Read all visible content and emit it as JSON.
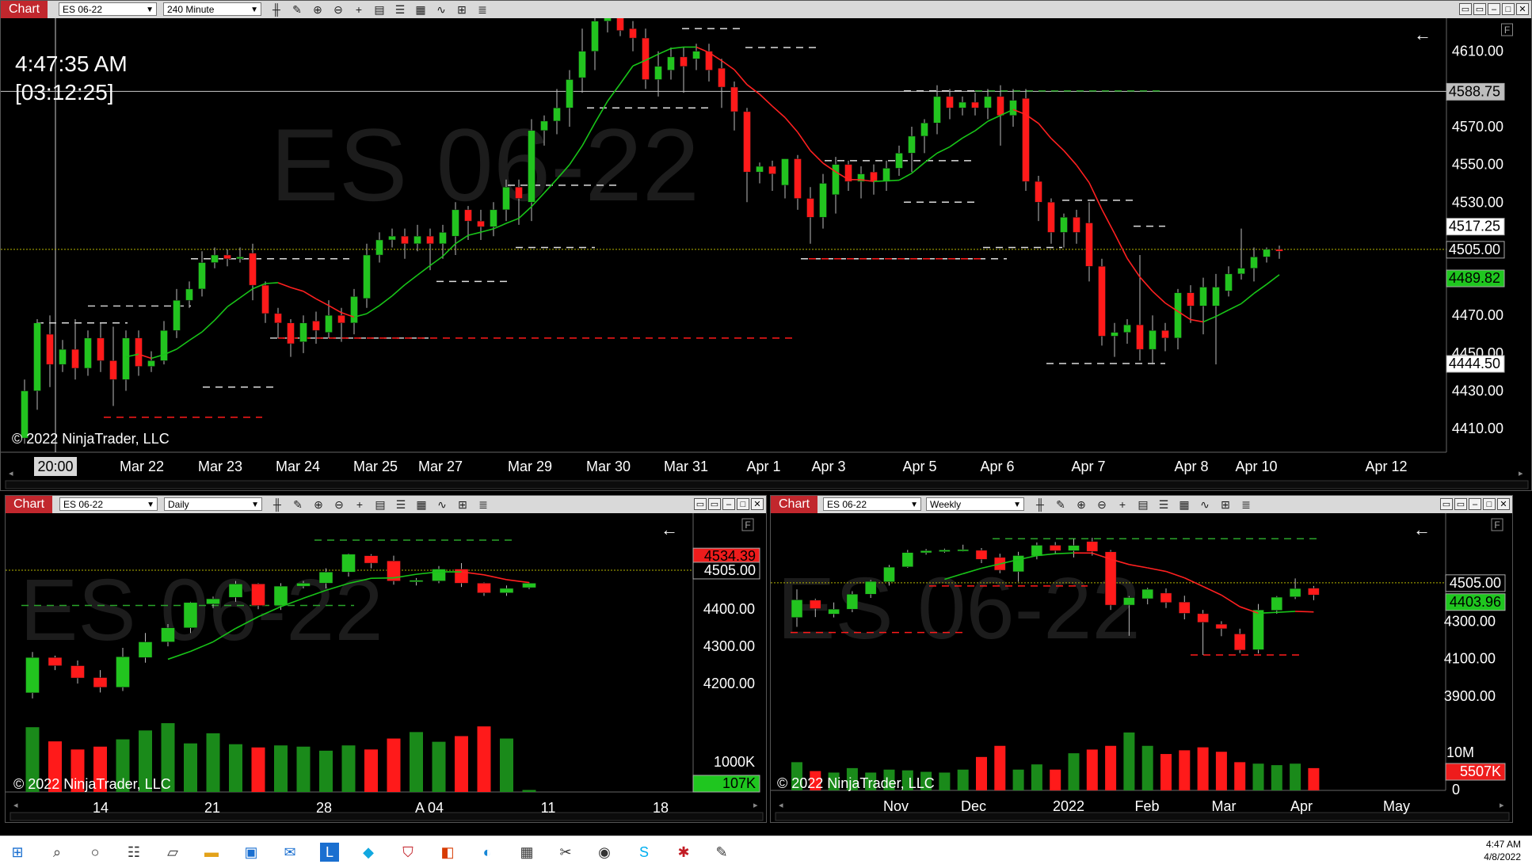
{
  "top": {
    "title": "Chart",
    "instrument": "ES 06-22",
    "interval": "240 Minute",
    "watermark": "ES 06-22",
    "time": "4:47:35 AM",
    "countdown": "[03:12:25]",
    "copyright": "© 2022 NinjaTrader, LLC",
    "cursor_x": "20:00",
    "x_labels": [
      "Mar 22",
      "Mar 23",
      "Mar 24",
      "Mar 25",
      "Mar 27",
      "Mar 29",
      "Mar 30",
      "Mar 31",
      "Apr 1",
      "Apr 3",
      "Apr 5",
      "Apr 6",
      "Apr 7",
      "Apr 8",
      "Apr 10",
      "Apr 12"
    ],
    "y_labels": [
      "4610.00",
      "4570.00",
      "4550.00",
      "4530.00",
      "4470.00",
      "4430.00",
      "4410.00"
    ],
    "y_partial": "4450.00",
    "price_tags": {
      "p1": "4588.75",
      "p2": "4517.25",
      "p3": "4505.00",
      "p4": "4489.82",
      "p5": "4444.50"
    },
    "f_label": "F"
  },
  "bl": {
    "title": "Chart",
    "instrument": "ES 06-22",
    "interval": "Daily",
    "watermark": "ES 06-22",
    "copyright": "© 2022 NinjaTrader, LLC",
    "x_labels": [
      "14",
      "21",
      "28",
      "A  04",
      "11",
      "18"
    ],
    "y_labels": [
      "4400.00",
      "4300.00",
      "4200.00",
      "1000K"
    ],
    "price_tags": {
      "p1": "4534.39",
      "p2": "4505.00",
      "p3": "107K"
    },
    "f_label": "F"
  },
  "br": {
    "title": "Chart",
    "instrument": "ES 06-22",
    "interval": "Weekly",
    "watermark": "ES 06-22",
    "copyright": "© 2022 NinjaTrader, LLC",
    "x_labels": [
      "Nov",
      "Dec",
      "2022",
      "Feb",
      "Mar",
      "Apr",
      "May"
    ],
    "y_labels": [
      "4300.00",
      "4100.00",
      "3900.00",
      "10M",
      "0"
    ],
    "price_tags": {
      "p1": "4505.00",
      "p2": "4403.96",
      "p3": "5507K"
    },
    "f_label": "F"
  },
  "taskbar": {
    "time": "4:47 AM",
    "date": "4/8/2022",
    "icons": [
      "windows-icon",
      "search-icon",
      "taskview-icon",
      "widgets-icon",
      "files-icon",
      "folder-icon",
      "store-icon",
      "mail-icon",
      "l-app-icon",
      "app-icon",
      "shield-icon",
      "office-icon",
      "edge-icon",
      "calculator-icon",
      "paint-icon",
      "chat-icon",
      "skype-icon",
      "ninja-icon",
      "notepad-icon"
    ]
  },
  "colors": {
    "up": "#22c41f",
    "down": "#ff1a1a",
    "sma_up": "#18c418",
    "sma_down": "#ff2020",
    "tag_green": "#1fc61f",
    "tag_red": "#ee1c1c",
    "titlebar": "#c1272d"
  },
  "chart_data": [
    {
      "type": "candlestick",
      "title": "ES 06-22 240 Minute",
      "x_ticks": [
        "Mar 22",
        "Mar 23",
        "Mar 24",
        "Mar 25",
        "Mar 27",
        "Mar 29",
        "Mar 30",
        "Mar 31",
        "Apr 1",
        "Apr 3",
        "Apr 5",
        "Apr 6",
        "Apr 7",
        "Apr 8",
        "Apr 10",
        "Apr 12"
      ],
      "ylim": [
        4400,
        4625
      ],
      "candles": [
        [
          4405,
          4430,
          4402,
          4436
        ],
        [
          4430,
          4466,
          4420,
          4468
        ],
        [
          4460,
          4444,
          4432,
          4470
        ],
        [
          4444,
          4452,
          4440,
          4457
        ],
        [
          4452,
          4442,
          4436,
          4468
        ],
        [
          4442,
          4458,
          4438,
          4462
        ],
        [
          4458,
          4446,
          4440,
          4466
        ],
        [
          4446,
          4436,
          4422,
          4464
        ],
        [
          4436,
          4458,
          4430,
          4462
        ],
        [
          4458,
          4443,
          4438,
          4462
        ],
        [
          4443,
          4446,
          4440,
          4451
        ],
        [
          4446,
          4462,
          4444,
          4467
        ],
        [
          4462,
          4478,
          4458,
          4484
        ],
        [
          4478,
          4484,
          4474,
          4488
        ],
        [
          4484,
          4498,
          4480,
          4504
        ],
        [
          4498,
          4502,
          4495,
          4506
        ],
        [
          4502,
          4500,
          4496,
          4505
        ],
        [
          4500,
          4501,
          4498,
          4506
        ],
        [
          4503,
          4486,
          4478,
          4508
        ],
        [
          4486,
          4471,
          4466,
          4488
        ],
        [
          4471,
          4466,
          4458,
          4474
        ],
        [
          4466,
          4455,
          4448,
          4468
        ],
        [
          4456,
          4466,
          4450,
          4470
        ],
        [
          4467,
          4462,
          4455,
          4472
        ],
        [
          4461,
          4470,
          4458,
          4478
        ],
        [
          4470,
          4466,
          4456,
          4474
        ],
        [
          4466,
          4480,
          4460,
          4484
        ],
        [
          4479,
          4502,
          4474,
          4508
        ],
        [
          4502,
          4510,
          4498,
          4514
        ],
        [
          4510,
          4512,
          4506,
          4516
        ],
        [
          4512,
          4508,
          4500,
          4516
        ],
        [
          4508,
          4512,
          4504,
          4518
        ],
        [
          4512,
          4508,
          4494,
          4516
        ],
        [
          4508,
          4514,
          4500,
          4518
        ],
        [
          4512,
          4526,
          4502,
          4530
        ],
        [
          4526,
          4520,
          4510,
          4528
        ],
        [
          4520,
          4517,
          4510,
          4526
        ],
        [
          4517,
          4526,
          4512,
          4530
        ],
        [
          4526,
          4538,
          4520,
          4542
        ],
        [
          4538,
          4532,
          4518,
          4542
        ],
        [
          4530,
          4568,
          4520,
          4574
        ],
        [
          4568,
          4573,
          4560,
          4576
        ],
        [
          4573,
          4580,
          4566,
          4590
        ],
        [
          4580,
          4595,
          4570,
          4600
        ],
        [
          4596,
          4610,
          4588,
          4622
        ],
        [
          4610,
          4626,
          4600,
          4630
        ],
        [
          4626,
          4630,
          4620,
          4634
        ],
        [
          4632,
          4621,
          4618,
          4633
        ],
        [
          4622,
          4617,
          4610,
          4626
        ],
        [
          4617,
          4595,
          4590,
          4622
        ],
        [
          4595,
          4602,
          4586,
          4610
        ],
        [
          4600,
          4607,
          4595,
          4612
        ],
        [
          4607,
          4602,
          4588,
          4612
        ],
        [
          4606,
          4610,
          4600,
          4614
        ],
        [
          4610,
          4600,
          4594,
          4614
        ],
        [
          4601,
          4591,
          4580,
          4606
        ],
        [
          4591,
          4578,
          4568,
          4594
        ],
        [
          4578,
          4546,
          4530,
          4580
        ],
        [
          4546,
          4549,
          4540,
          4551
        ],
        [
          4549,
          4545,
          4536,
          4552
        ],
        [
          4539,
          4553,
          4532,
          4553
        ],
        [
          4553,
          4532,
          4526,
          4555
        ],
        [
          4532,
          4522,
          4508,
          4538
        ],
        [
          4522,
          4540,
          4516,
          4545
        ],
        [
          4534,
          4550,
          4524,
          4554
        ],
        [
          4550,
          4541,
          4536,
          4552
        ],
        [
          4541,
          4545,
          4532,
          4549
        ],
        [
          4546,
          4541,
          4534,
          4550
        ],
        [
          4541,
          4548,
          4536,
          4552
        ],
        [
          4548,
          4556,
          4544,
          4560
        ],
        [
          4556,
          4565,
          4546,
          4570
        ],
        [
          4565,
          4572,
          4556,
          4574
        ],
        [
          4572,
          4586,
          4566,
          4592
        ],
        [
          4586,
          4580,
          4574,
          4590
        ],
        [
          4580,
          4583,
          4576,
          4586
        ],
        [
          4583,
          4580,
          4576,
          4588
        ],
        [
          4580,
          4586,
          4574,
          4590
        ],
        [
          4586,
          4576,
          4560,
          4592
        ],
        [
          4576,
          4584,
          4570,
          4590
        ],
        [
          4585,
          4541,
          4536,
          4590
        ],
        [
          4541,
          4530,
          4520,
          4544
        ],
        [
          4530,
          4514,
          4508,
          4532
        ],
        [
          4514,
          4522,
          4506,
          4524
        ],
        [
          4522,
          4514,
          4508,
          4526
        ],
        [
          4519,
          4496,
          4488,
          4530
        ],
        [
          4496,
          4459,
          4454,
          4500
        ],
        [
          4459,
          4461,
          4448,
          4466
        ],
        [
          4461,
          4465,
          4455,
          4468
        ],
        [
          4465,
          4452,
          4446,
          4502
        ],
        [
          4452,
          4462,
          4444,
          4470
        ],
        [
          4462,
          4458,
          4451,
          4466
        ],
        [
          4458,
          4482,
          4452,
          4484
        ],
        [
          4482,
          4475,
          4466,
          4486
        ],
        [
          4475,
          4485,
          4460,
          4490
        ],
        [
          4475,
          4485,
          4444,
          4492
        ],
        [
          4483,
          4492,
          4480,
          4496
        ],
        [
          4492,
          4495,
          4489,
          4516
        ],
        [
          4495,
          4501,
          4488,
          4506
        ],
        [
          4501,
          4505,
          4498,
          4506
        ],
        [
          4505,
          4504,
          4500,
          4507
        ]
      ]
    },
    {
      "type": "candlestick",
      "title": "ES 06-22 Daily",
      "x_ticks": [
        "14",
        "21",
        "28",
        "A  04",
        "11",
        "18"
      ],
      "ylim": [
        4100,
        4620
      ],
      "candles": [
        [
          4175,
          4270,
          4160,
          4285
        ],
        [
          4270,
          4248,
          4236,
          4275
        ],
        [
          4248,
          4215,
          4200,
          4262
        ],
        [
          4216,
          4190,
          4176,
          4236
        ],
        [
          4190,
          4272,
          4180,
          4296
        ],
        [
          4270,
          4312,
          4256,
          4336
        ],
        [
          4312,
          4350,
          4300,
          4360
        ],
        [
          4350,
          4418,
          4336,
          4420
        ],
        [
          4414,
          4428,
          4403,
          4434
        ],
        [
          4432,
          4468,
          4420,
          4476
        ],
        [
          4468,
          4410,
          4400,
          4470
        ],
        [
          4410,
          4462,
          4398,
          4470
        ],
        [
          4462,
          4470,
          4456,
          4476
        ],
        [
          4470,
          4500,
          4456,
          4510
        ],
        [
          4500,
          4548,
          4488,
          4550
        ],
        [
          4544,
          4524,
          4510,
          4548
        ],
        [
          4530,
          4476,
          4466,
          4544
        ],
        [
          4476,
          4478,
          4464,
          4484
        ],
        [
          4476,
          4508,
          4470,
          4516
        ],
        [
          4508,
          4470,
          4460,
          4524
        ],
        [
          4470,
          4444,
          4436,
          4472
        ],
        [
          4444,
          4456,
          4436,
          4464
        ],
        [
          4458,
          4470,
          4454,
          4472
        ]
      ],
      "volume": [
        1600,
        1250,
        1050,
        1120,
        1300,
        1520,
        1700,
        1200,
        1450,
        1180,
        1100,
        1150,
        1120,
        1020,
        1150,
        1050,
        1320,
        1480,
        1240,
        1380,
        1620,
        1320,
        50
      ]
    },
    {
      "type": "candlestick",
      "title": "ES 06-22 Weekly",
      "x_ticks": [
        "Nov",
        "Dec",
        "2022",
        "Feb",
        "Mar",
        "Apr",
        "May"
      ],
      "ylim": [
        3820,
        4800
      ],
      "candles": [
        [
          4320,
          4414,
          4270,
          4470
        ],
        [
          4412,
          4367,
          4322,
          4420
        ],
        [
          4338,
          4364,
          4320,
          4400
        ],
        [
          4364,
          4444,
          4348,
          4460
        ],
        [
          4444,
          4512,
          4424,
          4520
        ],
        [
          4510,
          4588,
          4490,
          4600
        ],
        [
          4590,
          4666,
          4585,
          4680
        ],
        [
          4665,
          4676,
          4655,
          4685
        ],
        [
          4671,
          4680,
          4665,
          4687
        ],
        [
          4680,
          4682,
          4672,
          4708
        ],
        [
          4678,
          4630,
          4610,
          4690
        ],
        [
          4640,
          4572,
          4556,
          4660
        ],
        [
          4564,
          4650,
          4510,
          4670
        ],
        [
          4648,
          4705,
          4630,
          4720
        ],
        [
          4705,
          4676,
          4658,
          4722
        ],
        [
          4676,
          4704,
          4640,
          4740
        ],
        [
          4725,
          4672,
          4650,
          4745
        ],
        [
          4670,
          4386,
          4360,
          4680
        ],
        [
          4386,
          4426,
          4222,
          4434
        ],
        [
          4420,
          4470,
          4390,
          4478
        ],
        [
          4450,
          4400,
          4370,
          4475
        ],
        [
          4402,
          4342,
          4310,
          4436
        ],
        [
          4340,
          4294,
          4120,
          4360
        ],
        [
          4284,
          4260,
          4220,
          4300
        ],
        [
          4232,
          4146,
          4130,
          4260
        ],
        [
          4148,
          4360,
          4128,
          4392
        ],
        [
          4358,
          4428,
          4340,
          4434
        ],
        [
          4430,
          4474,
          4418,
          4528
        ],
        [
          4476,
          4440,
          4412,
          4488
        ]
      ],
      "volume": [
        3.8,
        2.6,
        2.4,
        3.0,
        2.4,
        2.8,
        2.7,
        2.5,
        2.4,
        2.8,
        4.5,
        6.0,
        2.8,
        3.5,
        2.8,
        5.0,
        5.5,
        6.0,
        7.8,
        6.0,
        4.9,
        5.4,
        5.8,
        5.2,
        3.8,
        3.6,
        3.4,
        3.6,
        3.0
      ]
    }
  ]
}
